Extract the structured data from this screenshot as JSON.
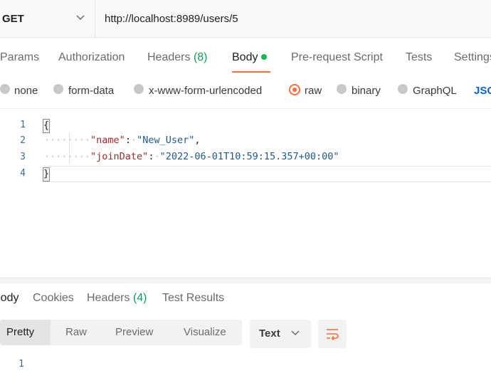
{
  "request": {
    "method": "GET",
    "url": "http://localhost:8989/users/5"
  },
  "request_tabs": [
    {
      "label": "Params"
    },
    {
      "label": "Authorization"
    },
    {
      "label": "Headers",
      "count": "(8)"
    },
    {
      "label": "Body",
      "active": true,
      "has_dot": true
    },
    {
      "label": "Pre-request Script"
    },
    {
      "label": "Tests"
    },
    {
      "label": "Settings"
    }
  ],
  "body_types": [
    {
      "label": "none"
    },
    {
      "label": "form-data"
    },
    {
      "label": "x-www-form-urlencoded"
    },
    {
      "label": "raw",
      "selected": true
    },
    {
      "label": "binary"
    },
    {
      "label": "GraphQL"
    },
    {
      "label": "JSON"
    }
  ],
  "editor": {
    "line_numbers": [
      "1",
      "2",
      "3",
      "4"
    ],
    "open_brace": "{",
    "close_brace": "}",
    "line2_key": "\"name\"",
    "line2_colon": ":",
    "line2_value": "\"New_User\"",
    "line2_comma": ",",
    "line3_key": "\"joinDate\"",
    "line3_colon": ":",
    "line3_value": "\"2022-06-01T10:59:15.357+00:00\""
  },
  "response_tabs": [
    {
      "label": "Body",
      "active": true
    },
    {
      "label": "Cookies"
    },
    {
      "label": "Headers",
      "count": "(4)"
    },
    {
      "label": "Test Results"
    }
  ],
  "response_view_modes": [
    "Pretty",
    "Raw",
    "Preview",
    "Visualize"
  ],
  "response_format": "Text",
  "response_line_numbers": [
    "1"
  ],
  "colors": {
    "accent": "#ff6c37",
    "status_green": "#0cbb52",
    "link_blue": "#0265d2"
  },
  "icons": [
    "chevron-down-icon",
    "wrap-lines-icon"
  ]
}
